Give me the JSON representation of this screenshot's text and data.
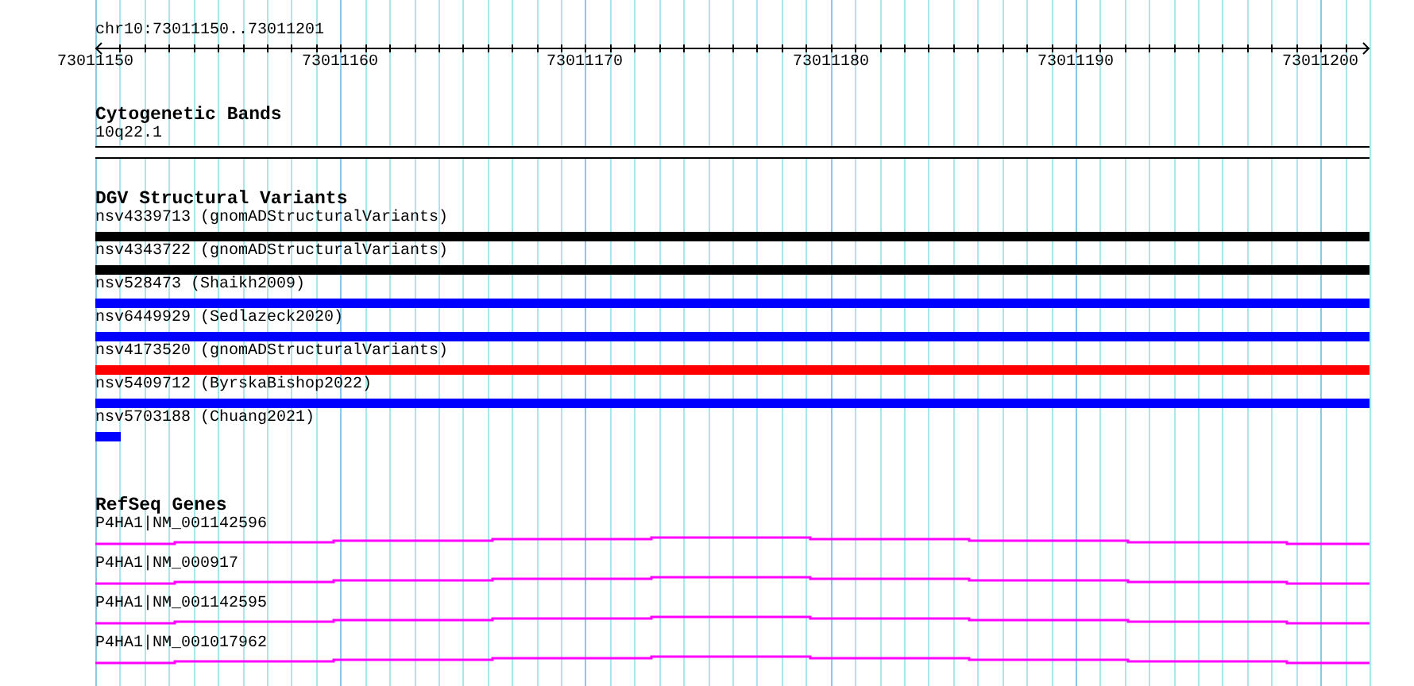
{
  "ruler": {
    "position": "chr10:73011150..73011201",
    "ticks": [
      "73011150",
      "73011160",
      "73011170",
      "73011180",
      "73011190",
      "73011200"
    ]
  },
  "tracks": [
    {
      "kind": "bands",
      "title": "Cytogenetic Bands",
      "items": [
        {
          "label": "10q22.1"
        }
      ]
    },
    {
      "kind": "variants",
      "title": "DGV Structural Variants",
      "items": [
        {
          "label": "nsv4339713 (gnomADStructuralVariants)",
          "color": "#000000",
          "kind": "spanning"
        },
        {
          "label": "nsv4343722 (gnomADStructuralVariants)",
          "color": "#000000",
          "kind": "spanning"
        },
        {
          "label": "nsv528473 (Shaikh2009)",
          "color": "#0000ff",
          "kind": "spanning"
        },
        {
          "label": "nsv6449929 (Sedlazeck2020)",
          "color": "#0000ff",
          "kind": "spanning"
        },
        {
          "label": "nsv4173520 (gnomADStructuralVariants)",
          "color": "#ff0000",
          "kind": "spanning"
        },
        {
          "label": "nsv5409712 (ByrskaBishop2022)",
          "color": "#0000ff",
          "kind": "spanning"
        },
        {
          "label": "nsv5703188 (Chuang2021)",
          "color": "#0000ff",
          "kind": "short"
        }
      ]
    },
    {
      "kind": "genes",
      "title": "RefSeq Genes",
      "items": [
        {
          "label": "P4HA1|NM_001142596"
        },
        {
          "label": "P4HA1|NM_000917"
        },
        {
          "label": "P4HA1|NM_001142595"
        },
        {
          "label": "P4HA1|NM_001017962"
        }
      ]
    }
  ]
}
